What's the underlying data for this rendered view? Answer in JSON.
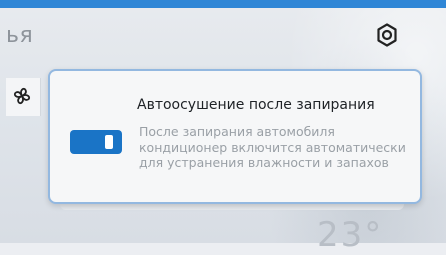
{
  "background": {
    "title_fragment": "ья",
    "temperature_fragment": "23°"
  },
  "icons": {
    "settings": "gear-icon",
    "fan": "fan-icon"
  },
  "dialog": {
    "title": "Автоосушение после запирания",
    "description": "После запирания автомобиля кондиционер включится автоматически для устранения влажности и запахов",
    "toggle": {
      "state": "on",
      "accent_color": "#1a74c6"
    }
  },
  "colors": {
    "accent": "#2f86d6",
    "card_border": "#93b8e0"
  }
}
